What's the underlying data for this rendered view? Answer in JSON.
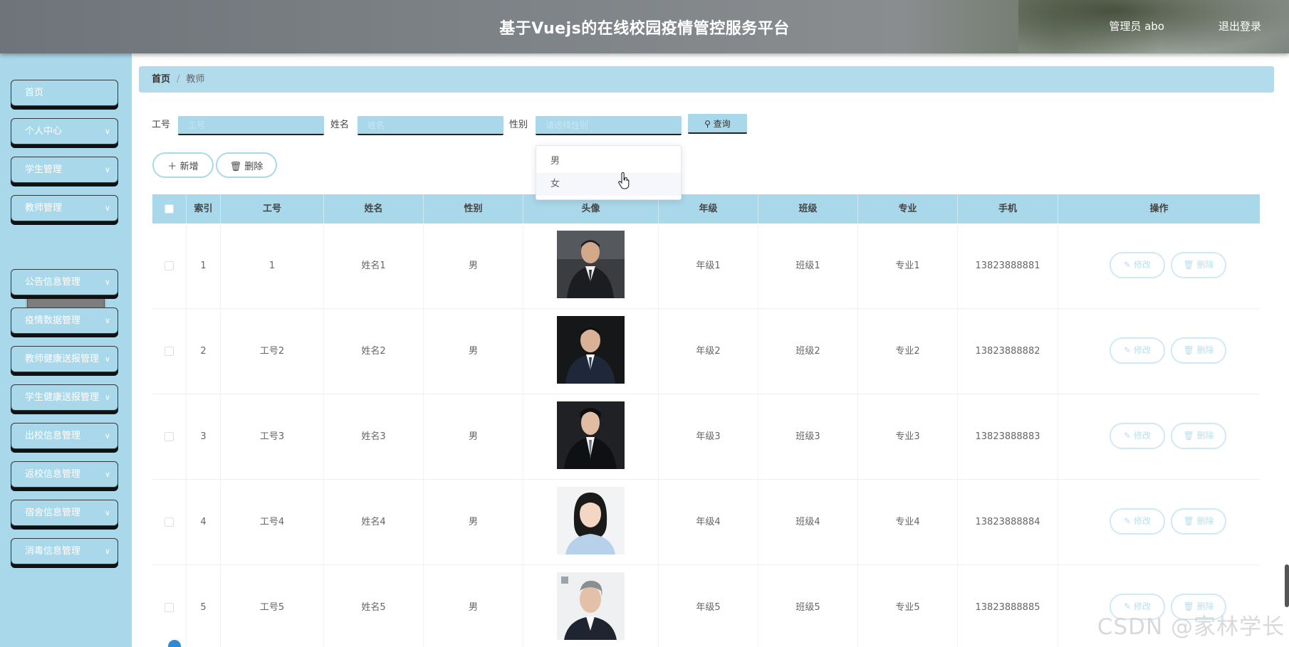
{
  "header": {
    "title": "基于Vuejs的在线校园疫情管控服务平台",
    "user": "管理员 abo",
    "logout": "退出登录"
  },
  "sidebar": {
    "items": [
      {
        "label": "首页",
        "chevron": false
      },
      {
        "label": "个人中心",
        "chevron": true
      },
      {
        "label": "学生管理",
        "chevron": true
      },
      {
        "label": "教师管理",
        "chevron": true
      },
      {
        "label": "公告信息管理",
        "chevron": true
      },
      {
        "label": "疫情数据管理",
        "chevron": true
      },
      {
        "label": "教师健康送报管理",
        "chevron": true
      },
      {
        "label": "学生健康送报管理",
        "chevron": true
      },
      {
        "label": "出校信息管理",
        "chevron": true
      },
      {
        "label": "返校信息管理",
        "chevron": true
      },
      {
        "label": "宿舍信息管理",
        "chevron": true
      },
      {
        "label": "消毒信息管理",
        "chevron": true
      }
    ],
    "active_sub": "教师"
  },
  "breadcrumb": {
    "home": "首页",
    "separator": "/",
    "current": "教师"
  },
  "filters": {
    "gonghao_label": "工号",
    "gonghao_placeholder": "工号",
    "name_label": "姓名",
    "name_placeholder": "姓名",
    "gender_label": "性别",
    "gender_placeholder": "请选择性别",
    "search_label": "查询"
  },
  "dropdown": {
    "options": [
      "男",
      "女"
    ],
    "hovered": "女"
  },
  "actions": {
    "add_label": "新增",
    "delete_label": "删除"
  },
  "table": {
    "columns": [
      "索引",
      "工号",
      "姓名",
      "性别",
      "头像",
      "年级",
      "班级",
      "专业",
      "手机",
      "操作"
    ],
    "edit_label": "修改",
    "delete_label": "删除",
    "rows": [
      {
        "index": "1",
        "gonghao": "1",
        "name": "姓名1",
        "gender": "男",
        "grade": "年级1",
        "class": "班级1",
        "major": "专业1",
        "phone": "13823888881"
      },
      {
        "index": "2",
        "gonghao": "工号2",
        "name": "姓名2",
        "gender": "男",
        "grade": "年级2",
        "class": "班级2",
        "major": "专业2",
        "phone": "13823888882"
      },
      {
        "index": "3",
        "gonghao": "工号3",
        "name": "姓名3",
        "gender": "男",
        "grade": "年级3",
        "class": "班级3",
        "major": "专业3",
        "phone": "13823888883"
      },
      {
        "index": "4",
        "gonghao": "工号4",
        "name": "姓名4",
        "gender": "男",
        "grade": "年级4",
        "class": "班级4",
        "major": "专业4",
        "phone": "13823888884"
      },
      {
        "index": "5",
        "gonghao": "工号5",
        "name": "姓名5",
        "gender": "男",
        "grade": "年级5",
        "class": "班级5",
        "major": "专业5",
        "phone": "13823888885"
      }
    ]
  },
  "watermark": "CSDN @家林学长",
  "colors": {
    "accent": "#a9d8ea",
    "sidebar_bg": "#a9d8ea",
    "sub_active": "#7d7d7d"
  }
}
